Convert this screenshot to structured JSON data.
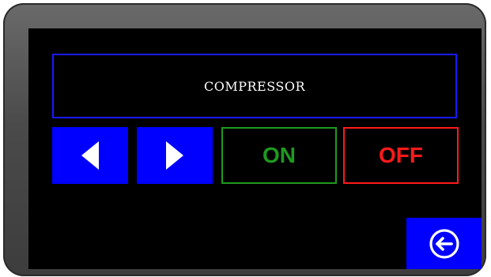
{
  "panel": {
    "title": "COMPRESSOR",
    "on_label": "ON",
    "off_label": "OFF"
  },
  "icons": {
    "prev": "triangle-left-icon",
    "next": "triangle-right-icon",
    "back": "circle-arrow-left-icon"
  },
  "colors": {
    "screen_background": "#000000",
    "bezel": "#4a4a4a",
    "nav_button": "#0000ff",
    "title_border": "#1a1aff",
    "on_color": "#1f9a1f",
    "off_color": "#ff1a1a",
    "text": "#ffffff"
  }
}
